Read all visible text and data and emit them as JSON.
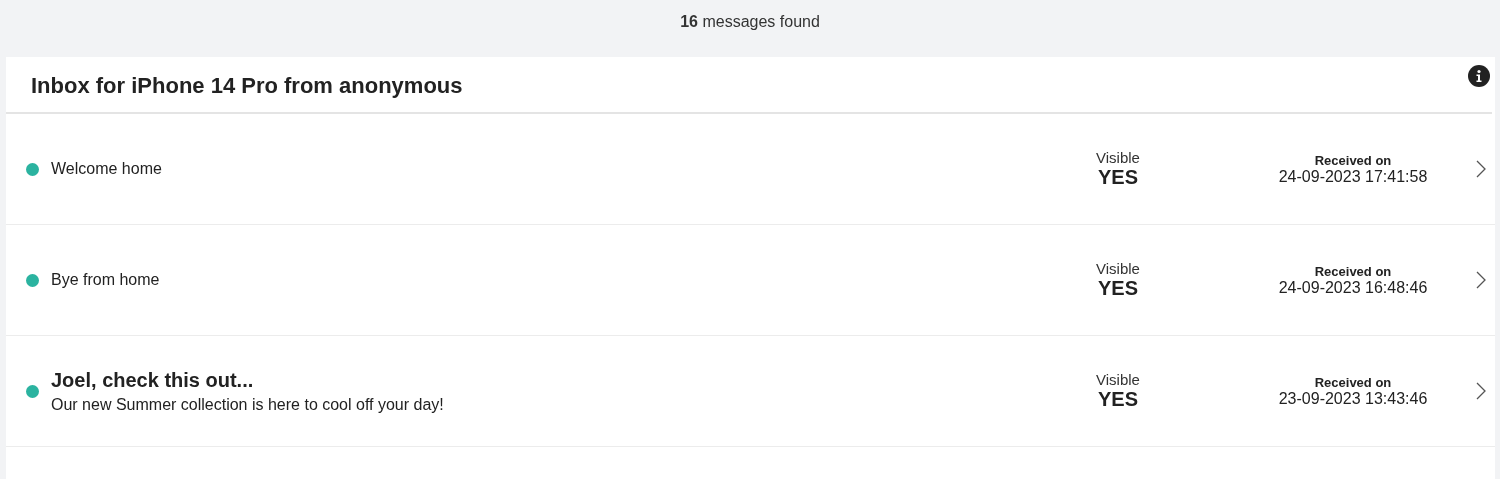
{
  "summary": "**16** messages found",
  "inbox": {
    "title": "Inbox for iPhone 14 Pro from anonymous",
    "messages": [
      {
        "kind": "simple",
        "color": "#2bb3a0",
        "title": "Welcome home",
        "visible_label": "Visible",
        "visible_value": "YES",
        "received_label": "Received on",
        "received_value": "24-09-2023 17:41:58"
      },
      {
        "kind": "simple",
        "color": "#2bb3a0",
        "title": "Bye from home",
        "visible_label": "Visible",
        "visible_value": "YES",
        "received_label": "Received on",
        "received_value": "24-09-2023 16:48:46"
      },
      {
        "kind": "rich",
        "color": "#2bb3a0",
        "title": "Joel, check this out...",
        "body": "Our new Summer collection is here to cool off your day!",
        "visible_label": "Visible",
        "visible_value": "YES",
        "received_label": "Received on",
        "received_value": "23-09-2023 13:43:46"
      }
    ]
  }
}
